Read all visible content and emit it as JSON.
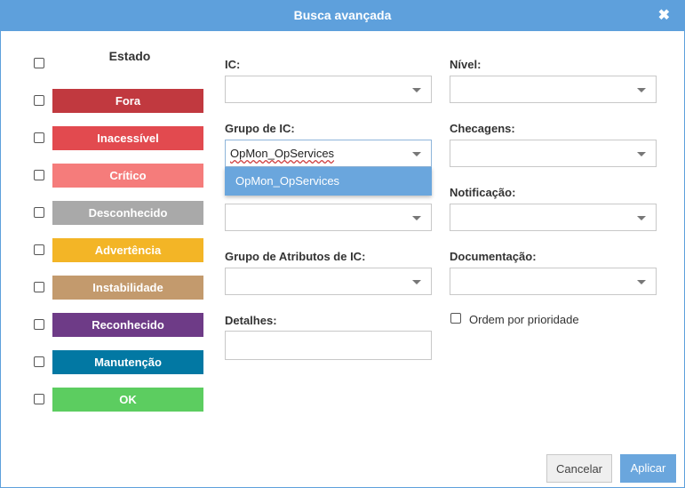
{
  "dialog": {
    "title": "Busca avançada",
    "close_glyph": "✖"
  },
  "states": {
    "header": "Estado",
    "items": [
      {
        "label": "Fora",
        "color": "#c1393f"
      },
      {
        "label": "Inacessível",
        "color": "#e24a4f"
      },
      {
        "label": "Crítico",
        "color": "#f57c7b"
      },
      {
        "label": "Desconhecido",
        "color": "#a9a9a9"
      },
      {
        "label": "Advertência",
        "color": "#f3b526"
      },
      {
        "label": "Instabilidade",
        "color": "#c39a6d"
      },
      {
        "label": "Reconhecido",
        "color": "#6e3b87"
      },
      {
        "label": "Manutenção",
        "color": "#0278a3"
      },
      {
        "label": "OK",
        "color": "#5ccd60"
      }
    ]
  },
  "fields": {
    "ic": {
      "label": "IC:",
      "value": ""
    },
    "nivel": {
      "label": "Nível:",
      "value": ""
    },
    "grupo_ic": {
      "label": "Grupo de IC:",
      "value": "OpMon_OpServices"
    },
    "checagens": {
      "label": "Checagens:",
      "value": ""
    },
    "notificacao": {
      "label": "Notificação:",
      "value": ""
    },
    "grupo_atributos": {
      "label": "Grupo de Atributos de IC:",
      "value": ""
    },
    "documentacao": {
      "label": "Documentação:",
      "value": ""
    },
    "detalhes": {
      "label": "Detalhes:",
      "value": ""
    },
    "ordem_prioridade": {
      "label": "Ordem por prioridade",
      "checked": false
    }
  },
  "dropdown_open": {
    "options": [
      "OpMon_OpServices"
    ]
  },
  "buttons": {
    "cancel": "Cancelar",
    "apply": "Aplicar"
  }
}
